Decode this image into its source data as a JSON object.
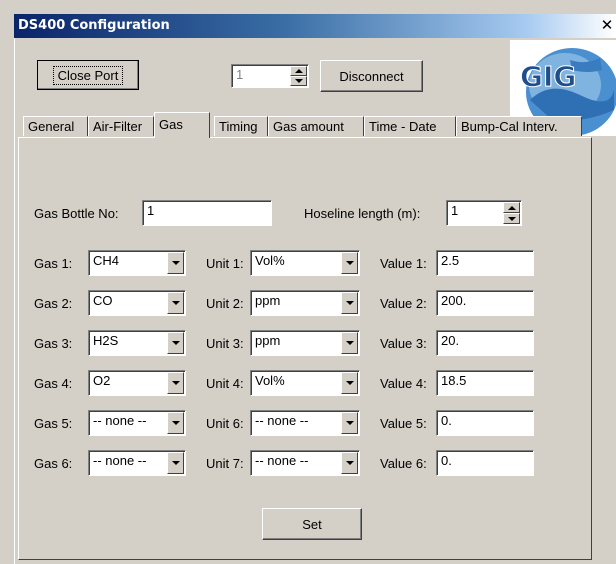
{
  "window": {
    "title": "DS400 Configuration",
    "close_glyph": "✕"
  },
  "toolbar": {
    "close_port_label": "Close Port",
    "port_value": "1",
    "disconnect_label": "Disconnect"
  },
  "logo": {
    "text": "GIG",
    "icon": "globe-logo"
  },
  "tabs": [
    {
      "label": "General"
    },
    {
      "label": "Air-Filter"
    },
    {
      "label": "Gas",
      "active": true
    },
    {
      "label": "Timing"
    },
    {
      "label": "Gas amount"
    },
    {
      "label": "Time - Date"
    },
    {
      "label": "Bump-Cal Interv."
    }
  ],
  "gas_tab": {
    "bottle_label": "Gas Bottle No:",
    "bottle_value": "1",
    "hoseline_label": "Hoseline length (m):",
    "hoseline_value": "1",
    "rows": [
      {
        "gas_label": "Gas 1:",
        "gas": "CH4",
        "unit_label": "Unit 1:",
        "unit": "Vol%",
        "value_label": "Value 1:",
        "value": "2.5"
      },
      {
        "gas_label": "Gas 2:",
        "gas": "CO",
        "unit_label": "Unit 2:",
        "unit": "ppm",
        "value_label": "Value 2:",
        "value": "200."
      },
      {
        "gas_label": "Gas 3:",
        "gas": "H2S",
        "unit_label": "Unit 3:",
        "unit": "ppm",
        "value_label": "Value 3:",
        "value": "20."
      },
      {
        "gas_label": "Gas 4:",
        "gas": "O2",
        "unit_label": "Unit 4:",
        "unit": "Vol%",
        "value_label": "Value 4:",
        "value": "18.5"
      },
      {
        "gas_label": "Gas 5:",
        "gas": "-- none --",
        "unit_label": "Unit 6:",
        "unit": "-- none --",
        "value_label": "Value 5:",
        "value": "0."
      },
      {
        "gas_label": "Gas 6:",
        "gas": "-- none --",
        "unit_label": "Unit 7:",
        "unit": "-- none --",
        "value_label": "Value 6:",
        "value": "0."
      }
    ],
    "set_label": "Set"
  },
  "colors": {
    "face": "#d4d0c8",
    "title_start": "#0a246a",
    "title_end": "#a6caf0"
  }
}
